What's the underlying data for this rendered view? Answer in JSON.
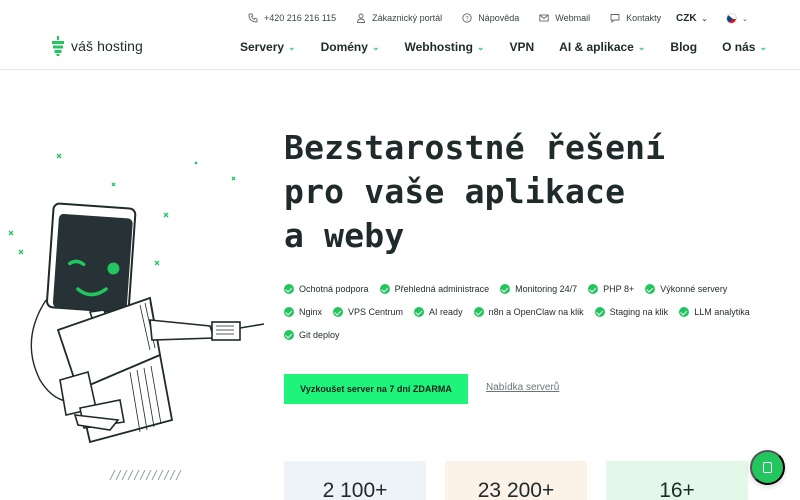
{
  "brand": {
    "name": "váš hosting",
    "accent": "#22c55e",
    "cta_color": "#1ff47a"
  },
  "utility": [
    {
      "icon": "phone-icon",
      "label": "+420 216 216 115"
    },
    {
      "icon": "user-icon",
      "label": "Zákaznický portál"
    },
    {
      "icon": "help-icon",
      "label": "Nápověda"
    },
    {
      "icon": "mail-icon",
      "label": "Webmail"
    },
    {
      "icon": "chat-bubble-icon",
      "label": "Kontakty"
    }
  ],
  "currency": "CZK",
  "language_flag": "czech-flag-icon",
  "nav": [
    {
      "label": "Servery",
      "dropdown": true
    },
    {
      "label": "Domény",
      "dropdown": true
    },
    {
      "label": "Webhosting",
      "dropdown": true
    },
    {
      "label": "VPN",
      "dropdown": false
    },
    {
      "label": "AI & aplikace",
      "dropdown": true
    },
    {
      "label": "Blog",
      "dropdown": false
    },
    {
      "label": "O nás",
      "dropdown": true
    }
  ],
  "hero": {
    "headline_lines": [
      "Bezstarostné řešení",
      "pro vaše aplikace",
      "a weby"
    ],
    "features": [
      "Ochotná podpora",
      "Přehledná administrace",
      "Monitoring 24/7",
      "PHP 8+",
      "Výkonné servery",
      "Nginx",
      "VPS Centrum",
      "AI ready",
      "n8n a OpenClaw na klik",
      "Staging na klik",
      "LLM analytika",
      "Git deploy"
    ],
    "cta_label": "Vyzkoušet server na 7 dní ZDARMA",
    "secondary_label": "Nabídka serverů"
  },
  "stats": [
    "2 100+",
    "23 200+",
    "16+"
  ]
}
